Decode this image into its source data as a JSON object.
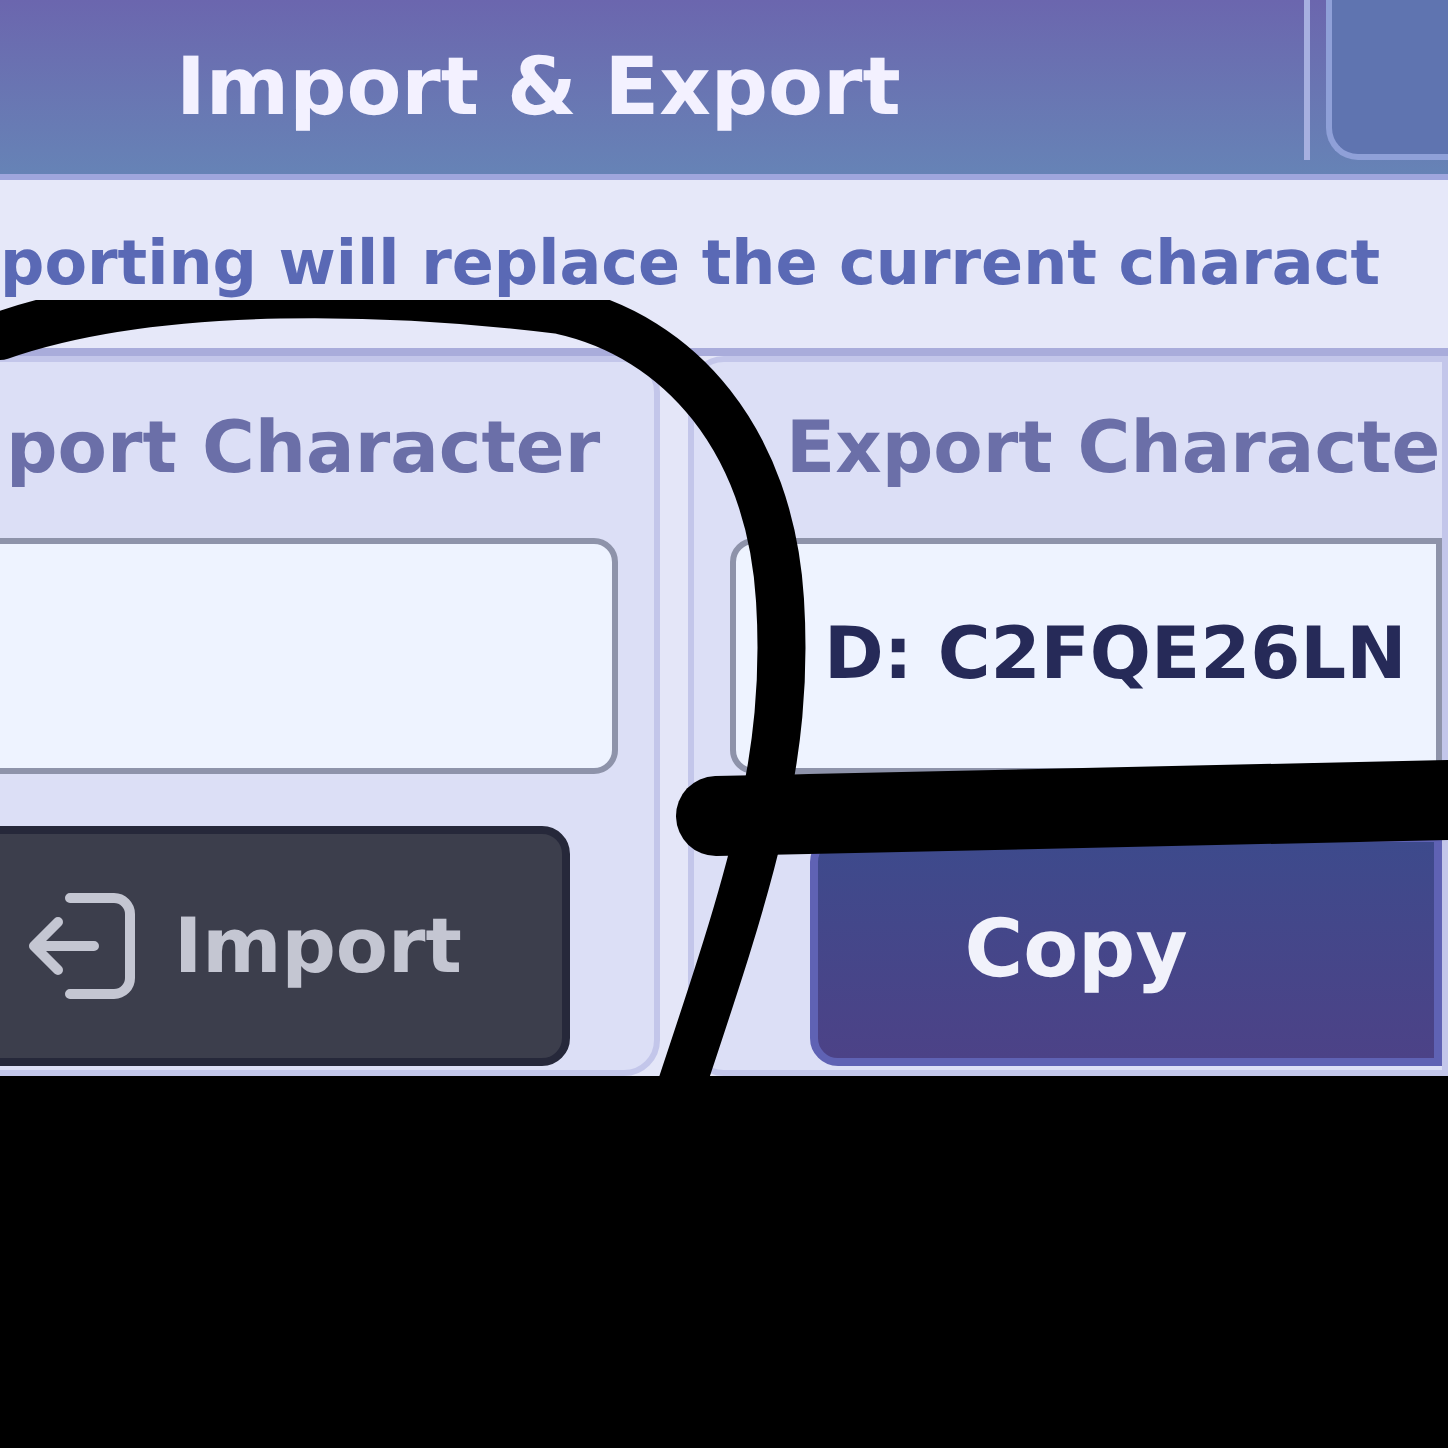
{
  "header": {
    "title": "Import & Export"
  },
  "notice": "porting will replace the current charact",
  "panels": [
    {
      "kind": "import",
      "heading": "port Character",
      "button": {
        "label": "Import"
      }
    },
    {
      "kind": "export",
      "heading": "Export Characte",
      "field": {
        "value": "D: C2FQE26LN"
      },
      "button": {
        "label": "Copy"
      }
    }
  ]
}
